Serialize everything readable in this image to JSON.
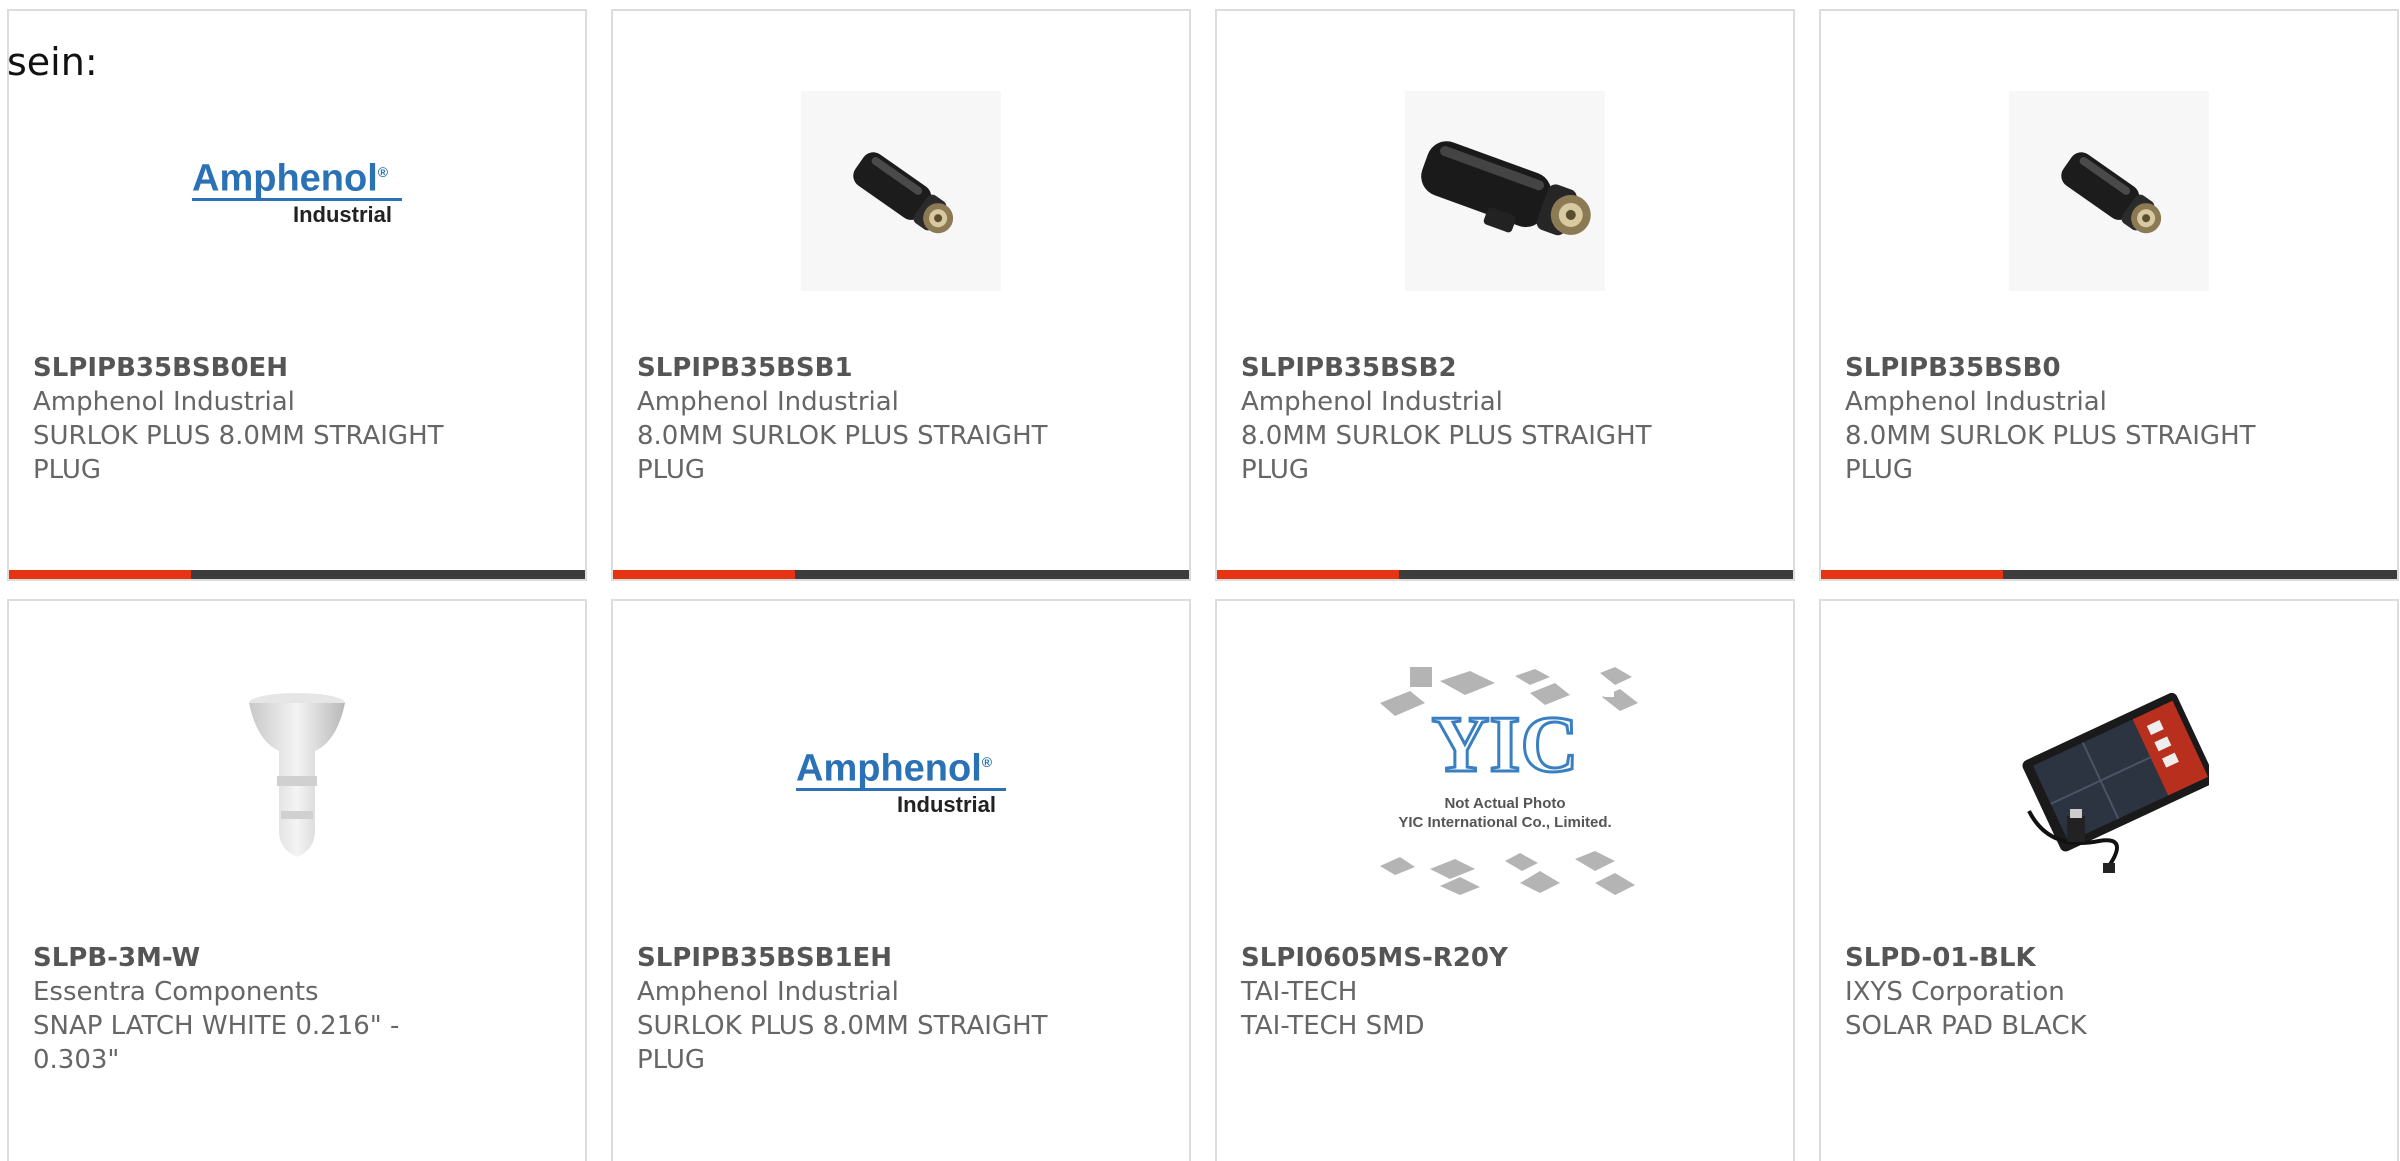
{
  "partial_text": "sein:",
  "products": [
    {
      "part_number": "SLPIPB35BSB0EH",
      "manufacturer": "Amphenol Industrial",
      "description": "SURLOK PLUS 8.0MM STRAIGHT PLUG",
      "image": "amphenol-logo",
      "logo_name": "Amphenol",
      "logo_sub": "Industrial"
    },
    {
      "part_number": "SLPIPB35BSB1",
      "manufacturer": "Amphenol Industrial",
      "description": "8.0MM SURLOK PLUS STRAIGHT PLUG",
      "image": "plug-photo"
    },
    {
      "part_number": "SLPIPB35BSB2",
      "manufacturer": "Amphenol Industrial",
      "description": "8.0MM SURLOK PLUS STRAIGHT PLUG",
      "image": "plug-photo-large"
    },
    {
      "part_number": "SLPIPB35BSB0",
      "manufacturer": "Amphenol Industrial",
      "description": "8.0MM SURLOK PLUS STRAIGHT PLUG",
      "image": "plug-photo"
    },
    {
      "part_number": "SLPB-3M-W",
      "manufacturer": "Essentra Components",
      "description": "SNAP LATCH WHITE 0.216\" - 0.303\"",
      "image": "snap-latch-photo"
    },
    {
      "part_number": "SLPIPB35BSB1EH",
      "manufacturer": "Amphenol Industrial",
      "description": "SURLOK PLUS 8.0MM STRAIGHT PLUG",
      "image": "amphenol-logo",
      "logo_name": "Amphenol",
      "logo_sub": "Industrial"
    },
    {
      "part_number": "SLPI0605MS-R20Y",
      "manufacturer": "TAI-TECH",
      "description": "TAI-TECH SMD",
      "image": "yic-placeholder",
      "placeholder_line1": "Not Actual Photo",
      "placeholder_line2": "YIC International Co., Limited."
    },
    {
      "part_number": "SLPD-01-BLK",
      "manufacturer": "IXYS Corporation",
      "description": "SOLAR PAD BLACK",
      "image": "solar-pad-photo"
    }
  ],
  "colors": {
    "accent": "#e63312",
    "bar": "#3d3d3d",
    "brand_blue": "#2a71b5"
  }
}
